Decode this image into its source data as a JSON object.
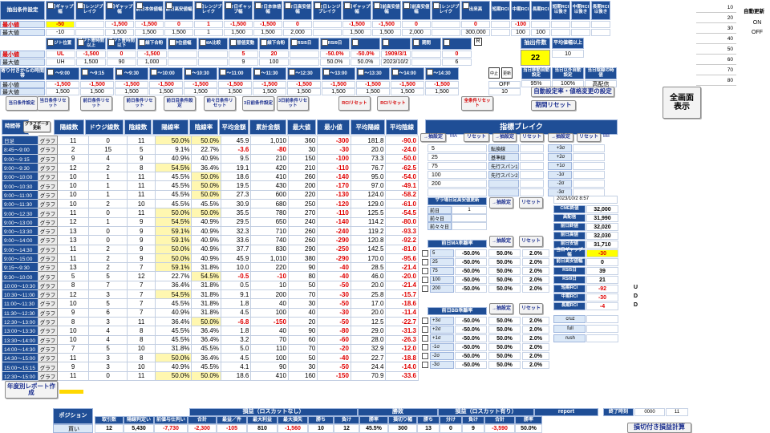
{
  "top": {
    "r1_labels": [
      "抽出条件設定",
      "当日ギャップ幅",
      "当日レンジブレイク",
      "前日ギャップ幅",
      "前日本体値幅",
      "前日高安値幅",
      "前日レンジブレイク",
      "前々日ギャップ幅",
      "前々日本体値幅",
      "前々日高安値幅",
      "前々日レンジブレイク",
      "前日ギャップ幅",
      "前日前高安値幅",
      "前日前高安値幅",
      "前日レンジブレイク",
      "出来高",
      "短期RCI",
      "中期RCI",
      "長期RCI",
      "短期RCI以後き",
      "中期RCI以後き",
      "長期RCI以後き"
    ],
    "min_label": "最小値",
    "max_label": "最大値",
    "r1_min": [
      "-50",
      "",
      "-1,500",
      "-1,500",
      "0",
      "1",
      "-1,500",
      "-1,500",
      "0",
      "",
      "-1,500",
      "-1,500",
      "0",
      "",
      "0",
      "",
      "-100",
      "",
      ""
    ],
    "r1_max": [
      "-10",
      "",
      "1,500",
      "1,500",
      "1,500",
      "1",
      "1,500",
      "1,500",
      "2,000",
      "",
      "1,500",
      "1,500",
      "2,000",
      "",
      "300,000",
      "",
      "100",
      "100",
      ""
    ],
    "r2_labels": [
      "ポジト位置",
      "ポジト寄時間以上",
      "ポジト寄時間以下",
      "陽線下合粉",
      "中位値幅",
      "MA比較",
      "日替値変動",
      "陽線下合粉",
      "RSI5日",
      "RSI9日",
      "",
      "",
      "期間",
      "",
      "曜日",
      "",
      "抽出件数",
      "平均値幅以上"
    ],
    "r2_min": [
      "UL",
      "-1,500",
      "0",
      "-1,500",
      "",
      "",
      "5",
      "20",
      "",
      "-50.0%",
      "-50.0%",
      "1909/3/1",
      "",
      "0"
    ],
    "r2_max": [
      "UH",
      "1,500",
      "90",
      "1,000",
      "",
      "",
      "9",
      "100",
      "",
      "50.0%",
      "50.0%",
      "2023/10/2",
      "",
      "6"
    ],
    "r2_r_badge": "R",
    "extract_count_label": "抽出件数",
    "extract_count_value": "22",
    "avg_label": "平均値幅以上",
    "avg_value": "10",
    "r3_label": "寄り付きからの時間帯",
    "r3_times": [
      "〜9:00",
      "〜9:15",
      "〜9:30",
      "〜10:00",
      "〜10:30",
      "〜11:00",
      "〜11:30",
      "〜12:30",
      "〜13:00",
      "〜13:30",
      "〜14:00",
      "〜14:30",
      "〜15:00"
    ],
    "r3_badges": [
      "中止",
      "更新"
    ],
    "r3_min": [
      "-1,500",
      "-1,500",
      "-1,500",
      "-1,500",
      "-1,500",
      "-1,500",
      "-1,500",
      "-1,500",
      "-1,500",
      "-1,500",
      "-1,500",
      "-1,500"
    ],
    "r3_max": [
      "1,500",
      "1,500",
      "1,500",
      "1,500",
      "1,500",
      "1,500",
      "1,500",
      "1,500",
      "1,500",
      "1,500",
      "1,500",
      "1,500"
    ],
    "r3_off": "OFF",
    "r3_ten": "10",
    "r3_right_labels": [
      "当日移動自動設定",
      "当日以外自動設定",
      "当日陰線の時値",
      "直"
    ],
    "r3_right_vals": [
      "95%",
      "100%",
      "高配信"
    ],
    "auto_set_btn": "自動設定率・値格変更の設定",
    "period_reset_btn": "期間リセット",
    "fullscreen_btn": "全画面\n表示",
    "side_nums": [
      "10",
      "20",
      "30",
      "40",
      "50",
      "60",
      "70",
      "80"
    ],
    "auto_label": "自動更新",
    "on_label": "ON",
    "off_label": "OFF"
  },
  "buttons": [
    {
      "label": "当日条件設定"
    },
    {
      "label": "当日条件リセット"
    },
    {
      "label": "前日条件リセット"
    },
    {
      "label": "前日条件リセット"
    },
    {
      "label": "前日目条件設定"
    },
    {
      "label": "前々日条件リセット"
    },
    {
      "label": "3日前条件設定"
    },
    {
      "label": "3日前条件リセット"
    },
    {
      "label": "RCIリセット"
    },
    {
      "label": "RCIリセット"
    },
    {
      "label": "全条件リセット"
    }
  ],
  "table": {
    "title": "時間帯",
    "gbtn_top": "グラフデータ更新",
    "headers": [
      "陽線数",
      "ドウジ線数",
      "陰線数",
      "陽線率",
      "陰線率",
      "平均金額",
      "累計金額",
      "最大値",
      "最小値",
      "平均陽線",
      "平均陰線"
    ],
    "graph_label": "グラフ",
    "rows": [
      {
        "t": "日足",
        "v": [
          "11",
          "0",
          "11",
          "50.0%",
          "50.0%",
          "45.9",
          "1,010",
          "360",
          "-300",
          "181.8",
          "-90.0"
        ]
      },
      {
        "t": "8:45〜9:00",
        "v": [
          "2",
          "15",
          "5",
          "9.1%",
          "22.7%",
          "-3.6",
          "-80",
          "30",
          "-30",
          "20.0",
          "-24.0"
        ]
      },
      {
        "t": "9:00〜9:15",
        "v": [
          "9",
          "4",
          "9",
          "40.9%",
          "40.9%",
          "9.5",
          "210",
          "150",
          "-100",
          "73.3",
          "-50.0"
        ]
      },
      {
        "t": "9:00〜9:30",
        "v": [
          "12",
          "2",
          "8",
          "54.5%",
          "36.4%",
          "19.1",
          "420",
          "210",
          "-110",
          "76.7",
          "-62.5"
        ]
      },
      {
        "t": "9:00〜10:00",
        "v": [
          "10",
          "1",
          "11",
          "45.5%",
          "50.0%",
          "18.6",
          "410",
          "260",
          "-140",
          "95.0",
          "-54.0"
        ]
      },
      {
        "t": "9:00〜10:30",
        "v": [
          "10",
          "1",
          "11",
          "45.5%",
          "50.0%",
          "19.5",
          "430",
          "200",
          "-170",
          "97.0",
          "-49.1"
        ]
      },
      {
        "t": "9:00〜11:00",
        "v": [
          "10",
          "1",
          "11",
          "45.5%",
          "50.0%",
          "27.3",
          "600",
          "220",
          "-130",
          "124.0",
          "-58.2"
        ]
      },
      {
        "t": "9:00〜11:30",
        "v": [
          "10",
          "2",
          "10",
          "45.5%",
          "45.5%",
          "30.9",
          "680",
          "250",
          "-120",
          "129.0",
          "-61.0"
        ]
      },
      {
        "t": "9:00〜12:30",
        "v": [
          "11",
          "0",
          "11",
          "50.0%",
          "50.0%",
          "35.5",
          "780",
          "270",
          "-110",
          "125.5",
          "-54.5"
        ]
      },
      {
        "t": "9:00〜13:00",
        "v": [
          "12",
          "1",
          "9",
          "54.5%",
          "40.9%",
          "29.5",
          "650",
          "240",
          "-140",
          "114.2",
          "-80.0"
        ]
      },
      {
        "t": "9:00〜13:30",
        "v": [
          "13",
          "0",
          "9",
          "59.1%",
          "40.9%",
          "32.3",
          "710",
          "260",
          "-240",
          "119.2",
          "-93.3"
        ]
      },
      {
        "t": "9:00〜14:00",
        "v": [
          "13",
          "0",
          "9",
          "59.1%",
          "40.9%",
          "33.6",
          "740",
          "260",
          "-290",
          "120.8",
          "-92.2"
        ]
      },
      {
        "t": "9:00〜14:30",
        "v": [
          "11",
          "2",
          "9",
          "50.0%",
          "40.9%",
          "37.7",
          "830",
          "290",
          "-250",
          "142.5",
          "-81.0"
        ]
      },
      {
        "t": "9:00〜15:00",
        "v": [
          "11",
          "2",
          "9",
          "50.0%",
          "40.9%",
          "45.9",
          "1,010",
          "380",
          "-290",
          "170.0",
          "-95.6"
        ]
      },
      {
        "t": "9:15〜9:30",
        "v": [
          "13",
          "2",
          "7",
          "59.1%",
          "31.8%",
          "10.0",
          "220",
          "90",
          "-40",
          "28.5",
          "-21.4"
        ]
      },
      {
        "t": "9:30〜10:00",
        "v": [
          "5",
          "5",
          "12",
          "22.7%",
          "54.5%",
          "-0.5",
          "-10",
          "80",
          "-40",
          "46.0",
          "-20.0"
        ]
      },
      {
        "t": "10:00〜10:30",
        "v": [
          "8",
          "7",
          "7",
          "36.4%",
          "31.8%",
          "0.5",
          "10",
          "50",
          "-50",
          "20.0",
          "-21.4"
        ]
      },
      {
        "t": "10:30〜11:00",
        "v": [
          "12",
          "3",
          "7",
          "54.5%",
          "31.8%",
          "9.1",
          "200",
          "70",
          "-30",
          "25.8",
          "-15.7"
        ]
      },
      {
        "t": "11:00〜11:30",
        "v": [
          "10",
          "5",
          "7",
          "45.5%",
          "31.8%",
          "1.8",
          "40",
          "30",
          "-50",
          "17.0",
          "-18.6"
        ]
      },
      {
        "t": "11:30〜12:30",
        "v": [
          "9",
          "6",
          "7",
          "40.9%",
          "31.8%",
          "4.5",
          "100",
          "40",
          "-30",
          "20.0",
          "-11.4"
        ]
      },
      {
        "t": "12:30〜13:00",
        "v": [
          "8",
          "3",
          "11",
          "36.4%",
          "50.0%",
          "-6.8",
          "-150",
          "20",
          "-50",
          "12.5",
          "-22.7"
        ]
      },
      {
        "t": "13:00〜13:30",
        "v": [
          "10",
          "4",
          "8",
          "45.5%",
          "36.4%",
          "1.8",
          "40",
          "90",
          "-80",
          "29.0",
          "-31.3"
        ]
      },
      {
        "t": "13:30〜14:00",
        "v": [
          "10",
          "4",
          "8",
          "45.5%",
          "36.4%",
          "3.2",
          "70",
          "60",
          "-60",
          "28.0",
          "-26.3"
        ]
      },
      {
        "t": "14:00〜14:30",
        "v": [
          "7",
          "5",
          "10",
          "31.8%",
          "45.5%",
          "5.0",
          "110",
          "70",
          "-20",
          "32.9",
          "-12.0"
        ]
      },
      {
        "t": "14:30〜15:00",
        "v": [
          "11",
          "3",
          "8",
          "50.0%",
          "36.4%",
          "4.5",
          "100",
          "50",
          "-40",
          "22.7",
          "-18.8"
        ]
      },
      {
        "t": "15:00〜15:15",
        "v": [
          "9",
          "3",
          "10",
          "40.9%",
          "45.5%",
          "4.1",
          "90",
          "30",
          "-50",
          "24.4",
          "-14.0"
        ]
      },
      {
        "t": "12:30〜15:00",
        "v": [
          "11",
          "0",
          "11",
          "50.0%",
          "50.0%",
          "18.6",
          "410",
          "160",
          "-150",
          "70.9",
          "-33.6"
        ]
      }
    ]
  },
  "right": {
    "title": "指標ブレイク",
    "sub_labels": [
      "一日",
      "一日"
    ],
    "set_btn": "→抽設定",
    "reset_btn": "リセット",
    "ma_label": "MA",
    "bb_label": "BB",
    "ma_rows": [
      {
        "n": "5",
        "label": "転換線",
        "v": "+3σ"
      },
      {
        "n": "25",
        "label": "基準線",
        "v": "+2σ"
      },
      {
        "n": "75",
        "label": "先行スパン1",
        "v": "+1σ"
      },
      {
        "n": "100",
        "label": "先行スパン2",
        "v": "-1σ"
      },
      {
        "n": "200",
        "label": "",
        "v": "-2σ"
      },
      {
        "n": "",
        "label": "",
        "v": "-3σ"
      }
    ],
    "z_title": "ザラ場日足高安値更新",
    "z_rows": [
      "前日",
      "前々日",
      "前々々日"
    ],
    "z_val": "1",
    "info_date": "2023/10/2 8:57",
    "info_rows": [
      {
        "label": "CME終値",
        "value": "32,000"
      },
      {
        "label": "高配信",
        "value": "31,990"
      },
      {
        "label": "前日終値",
        "value": "32,020"
      },
      {
        "label": "前日高値",
        "value": "32,030"
      },
      {
        "label": "前日安値",
        "value": "31,710"
      },
      {
        "label": "当日ギャップ幅",
        "value": "-30"
      },
      {
        "label": "前日高安値幅",
        "value": "0"
      },
      {
        "label": "RSI5日",
        "value": "39"
      },
      {
        "label": "RSI9日",
        "value": "21"
      },
      {
        "label": "短期RCI",
        "value": "-92",
        "dir": "U"
      },
      {
        "label": "中期RCI",
        "value": "-30",
        "dir": "D"
      },
      {
        "label": "長期RCI",
        "value": "-4",
        "dir": "D"
      }
    ],
    "pct_title_ma": "前日MA乖離率",
    "ma_pct_rows": [
      {
        "k": "5",
        "a": "-50.0%",
        "b": "50.0%",
        "c": "2.0%"
      },
      {
        "k": "25",
        "a": "-50.0%",
        "b": "50.0%",
        "c": "2.0%"
      },
      {
        "k": "75",
        "a": "-50.0%",
        "b": "50.0%",
        "c": "2.0%"
      },
      {
        "k": "100",
        "a": "-50.0%",
        "b": "50.0%",
        "c": "2.0%"
      },
      {
        "k": "200",
        "a": "-50.0%",
        "b": "50.0%",
        "c": "2.0%"
      }
    ],
    "pct_title_bb": "前日BB乖離率",
    "bb_pct_rows": [
      {
        "k": "+3σ",
        "a": "-50.0%",
        "b": "50.0%",
        "c": "2.0%"
      },
      {
        "k": "+2σ",
        "a": "-50.0%",
        "b": "50.0%",
        "c": "2.0%"
      },
      {
        "k": "+1σ",
        "a": "-50.0%",
        "b": "50.0%",
        "c": "2.0%"
      },
      {
        "k": "-1σ",
        "a": "-50.0%",
        "b": "50.0%",
        "c": "2.0%"
      },
      {
        "k": "-2σ",
        "a": "-50.0%",
        "b": "50.0%",
        "c": "2.0%"
      },
      {
        "k": "-3σ",
        "a": "-50.0%",
        "b": "50.0%",
        "c": "2.0%"
      }
    ],
    "side_labels": [
      "cruz",
      "full",
      "rush"
    ]
  },
  "yearly_btn": "年度別レポート作成",
  "bottom": {
    "position_label": "ポジション",
    "buy_label": "買い",
    "group1": "損益（ロスカットなし）",
    "group2": "勝敗",
    "group3": "損益（ロスカット有り）",
    "report": "report",
    "end_label": "終了時刻",
    "end_hours": "0000",
    "end_val": "11",
    "headers": [
      "取引数",
      "陽線判定い",
      "前値与仕判い",
      "合計",
      "最益／件",
      "最大利益",
      "最大損失",
      "勝ち",
      "負け",
      "勝率",
      "損切り幅",
      "勝ち",
      "分け",
      "負け",
      "合計",
      "勝率"
    ],
    "values": [
      "12",
      "5,430",
      "-7,730",
      "-2,300",
      "-105",
      "810",
      "-1,560",
      "10",
      "12",
      "45.5%",
      "300",
      "13",
      "0",
      "9",
      "-3,590",
      "50.0%"
    ],
    "calc_btn": "損切付き損益計算"
  }
}
